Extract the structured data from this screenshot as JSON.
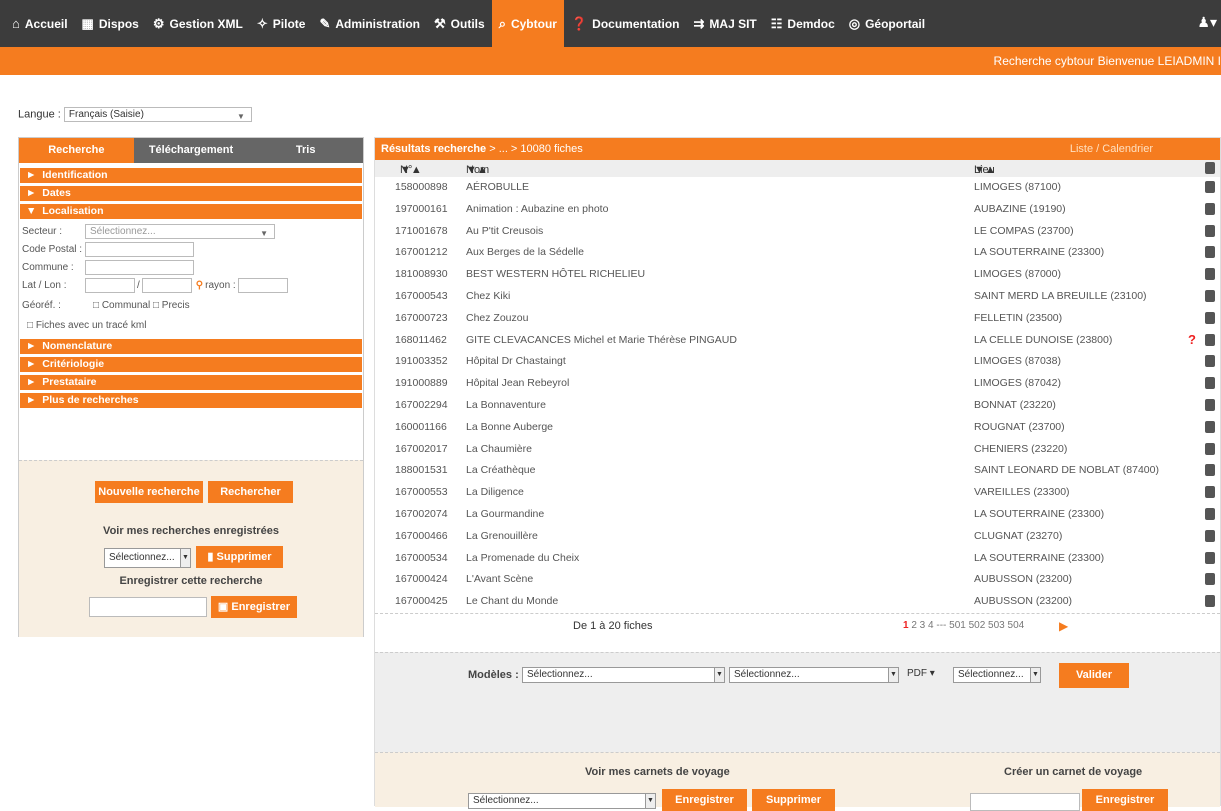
{
  "nav": [
    {
      "label": "Accueil",
      "icon": "home-icon",
      "glyph": "⌂"
    },
    {
      "label": "Dispos",
      "icon": "calendar-icon",
      "glyph": "▦"
    },
    {
      "label": "Gestion XML",
      "icon": "gear-icon",
      "glyph": "⚙"
    },
    {
      "label": "Pilote",
      "icon": "wand-icon",
      "glyph": "✧"
    },
    {
      "label": "Administration",
      "icon": "admin-icon",
      "glyph": "✎"
    },
    {
      "label": "Outils",
      "icon": "tools-icon",
      "glyph": "⚒"
    },
    {
      "label": "Cybtour",
      "icon": "search-icon",
      "glyph": "⌕"
    },
    {
      "label": "Documentation",
      "icon": "help-icon",
      "glyph": "❓"
    },
    {
      "label": "MAJ SIT",
      "icon": "update-icon",
      "glyph": "⇉"
    },
    {
      "label": "Demdoc",
      "icon": "users-icon",
      "glyph": "☷"
    },
    {
      "label": "Géoportail",
      "icon": "compass-icon",
      "glyph": "◎"
    }
  ],
  "banner": "Recherche cybtour Bienvenue LEIADMIN I",
  "langue": {
    "label": "Langue :",
    "value": "Français (Saisie)"
  },
  "tabs": [
    "Recherche",
    "Téléchargement",
    "Tris"
  ],
  "sections": {
    "identification": "Identification",
    "dates": "Dates",
    "localisation": "Localisation",
    "nomenclature": "Nomenclature",
    "criteriologie": "Critériologie",
    "prestataire": "Prestataire",
    "plus": "Plus de recherches"
  },
  "form": {
    "secteur": "Secteur :",
    "secteur_ph": "Sélectionnez...",
    "cp": "Code Postal :",
    "commune": "Commune :",
    "latlon": "Lat / Lon :",
    "sep": "/",
    "rayon": "rayon :",
    "georef": "Géoréf. :",
    "communal": "Communal",
    "precis": "Precis",
    "kml": "Fiches avec un tracé kml"
  },
  "left_actions": {
    "nouvelle": "Nouvelle recherche",
    "rechercher": "Rechercher",
    "voir": "Voir mes recherches enregistrées",
    "sel": "Sélectionnez...",
    "supprimer": "Supprimer",
    "enreg_title": "Enregistrer cette recherche",
    "enregistrer": "Enregistrer"
  },
  "results": {
    "title": "Résultats recherche",
    "crumb": " > ... > 10080 fiches",
    "views": "Liste / Calendrier",
    "col_num": "N°",
    "col_nom": "Nom",
    "col_lieu": "Lieu",
    "sort": "▼▲",
    "rows": [
      {
        "n": "158000898",
        "nom": "AÉROBULLE",
        "lieu": "LIMOGES (87100)",
        "q": ""
      },
      {
        "n": "197000161",
        "nom": "Animation : Aubazine en photo",
        "lieu": "AUBAZINE (19190)",
        "q": ""
      },
      {
        "n": "171001678",
        "nom": "Au P'tit Creusois",
        "lieu": "LE COMPAS (23700)",
        "q": ""
      },
      {
        "n": "167001212",
        "nom": "Aux Berges de la Sédelle",
        "lieu": "LA SOUTERRAINE (23300)",
        "q": ""
      },
      {
        "n": "181008930",
        "nom": "BEST WESTERN HÔTEL RICHELIEU",
        "lieu": "LIMOGES (87000)",
        "q": ""
      },
      {
        "n": "167000543",
        "nom": "Chez Kiki",
        "lieu": "SAINT MERD LA BREUILLE (23100)",
        "q": ""
      },
      {
        "n": "167000723",
        "nom": "Chez Zouzou",
        "lieu": "FELLETIN (23500)",
        "q": ""
      },
      {
        "n": "168011462",
        "nom": "GITE CLEVACANCES Michel et Marie Thérèse PINGAUD",
        "lieu": "LA CELLE DUNOISE (23800)",
        "q": "?"
      },
      {
        "n": "191003352",
        "nom": "Hôpital Dr Chastaingt",
        "lieu": "LIMOGES (87038)",
        "q": ""
      },
      {
        "n": "191000889",
        "nom": "Hôpital Jean Rebeyrol",
        "lieu": "LIMOGES (87042)",
        "q": ""
      },
      {
        "n": "167002294",
        "nom": "La Bonnaventure",
        "lieu": "BONNAT (23220)",
        "q": ""
      },
      {
        "n": "160001166",
        "nom": "La Bonne Auberge",
        "lieu": "ROUGNAT (23700)",
        "q": ""
      },
      {
        "n": "167002017",
        "nom": "La Chaumière",
        "lieu": "CHENIERS (23220)",
        "q": ""
      },
      {
        "n": "188001531",
        "nom": "La Créathèque",
        "lieu": "SAINT LEONARD DE NOBLAT (87400)",
        "q": ""
      },
      {
        "n": "167000553",
        "nom": "La Diligence",
        "lieu": "VAREILLES (23300)",
        "q": ""
      },
      {
        "n": "167002074",
        "nom": "La Gourmandine",
        "lieu": "LA SOUTERRAINE (23300)",
        "q": ""
      },
      {
        "n": "167000466",
        "nom": "La Grenouillère",
        "lieu": "CLUGNAT (23270)",
        "q": ""
      },
      {
        "n": "167000534",
        "nom": "La Promenade du Cheix",
        "lieu": "LA SOUTERRAINE (23300)",
        "q": ""
      },
      {
        "n": "167000424",
        "nom": "L'Avant Scène",
        "lieu": "AUBUSSON (23200)",
        "q": ""
      },
      {
        "n": "167000425",
        "nom": "Le Chant du Monde",
        "lieu": "AUBUSSON (23200)",
        "q": ""
      }
    ],
    "range": "De 1 à 20 fiches",
    "page_cur": "1",
    "pages": "2 3 4 --- 501 502 503 504"
  },
  "model": {
    "label": "Modèles :",
    "s1": "Sélectionnez...",
    "s2": "Sélectionnez...",
    "fmt": "PDF",
    "s3": "Sélectionnez...",
    "valider": "Valider"
  },
  "carnets": {
    "voir": "Voir mes carnets de voyage",
    "sel": "Sélectionnez...",
    "enregistrer": "Enregistrer",
    "supprimer": "Supprimer",
    "creer": "Créer un carnet de voyage",
    "enregistrer2": "Enregistrer"
  }
}
